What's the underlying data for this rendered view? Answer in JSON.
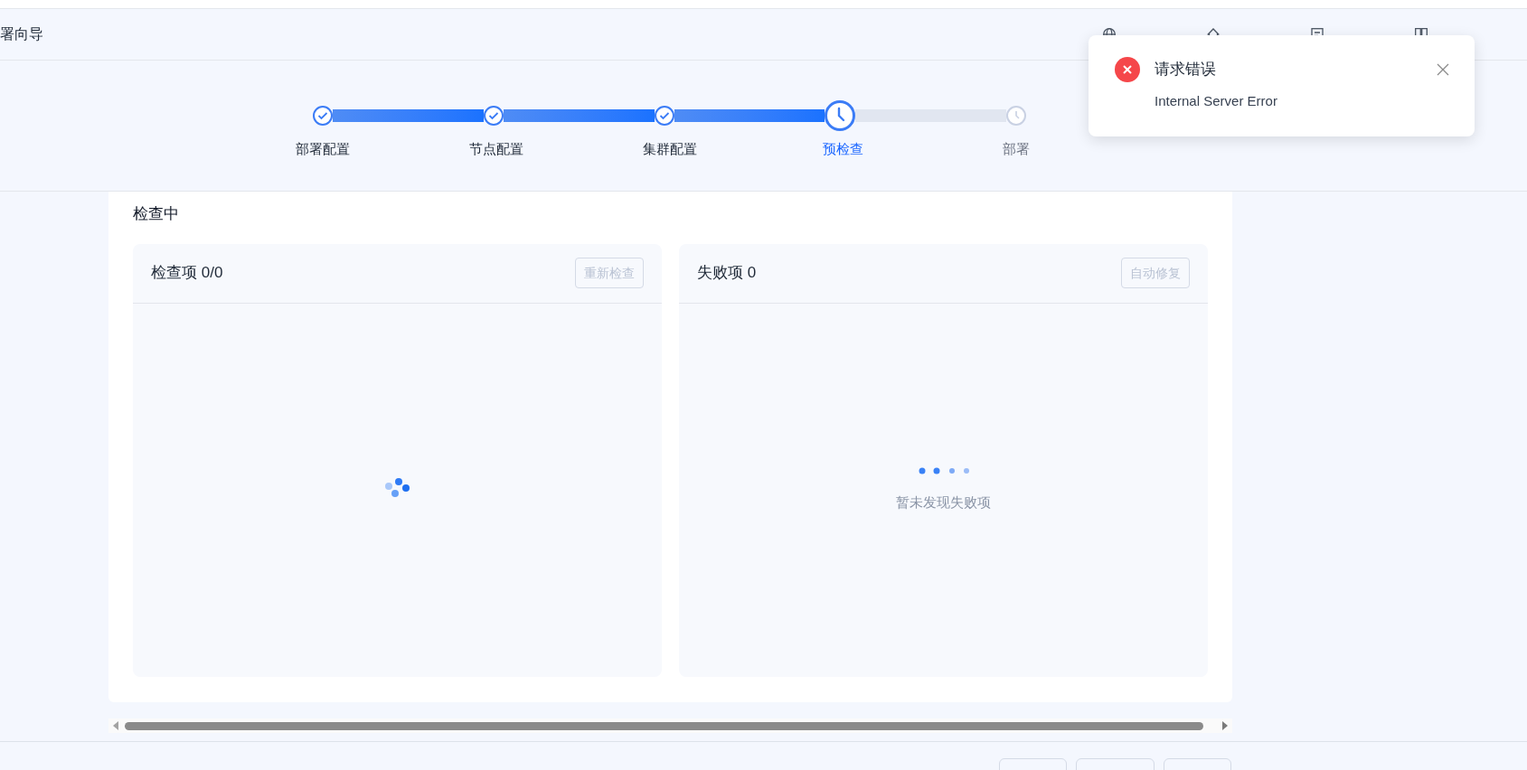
{
  "header": {
    "title": "署向导",
    "links": [
      {
        "kind": "globe"
      },
      {
        "kind": "home"
      },
      {
        "kind": "document"
      },
      {
        "kind": "book"
      }
    ]
  },
  "steps": [
    {
      "label": "部署配置",
      "kind": "done"
    },
    {
      "label": "节点配置",
      "kind": "done"
    },
    {
      "label": "集群配置",
      "kind": "done"
    },
    {
      "label": "预检查",
      "kind": "active"
    },
    {
      "label": "部署",
      "kind": "wait"
    }
  ],
  "section_title": "检查中",
  "panels": [
    {
      "title": "检查项",
      "count": "0/0",
      "button": {
        "label": "重新检查",
        "disabled": true
      },
      "loader": {
        "kind": "spinner"
      }
    },
    {
      "title": "失败项",
      "count": "0",
      "button": {
        "label": "自动修复",
        "disabled": true
      },
      "loader": {
        "kind": "dots"
      },
      "empty_text": "暂未发现失败项"
    }
  ],
  "footer_buttons": [
    {
      "disabled": false
    },
    {
      "disabled": false
    },
    {
      "disabled": false
    }
  ],
  "toast": {
    "kind": "error",
    "title": "请求错误",
    "message": "Internal Server Error"
  }
}
